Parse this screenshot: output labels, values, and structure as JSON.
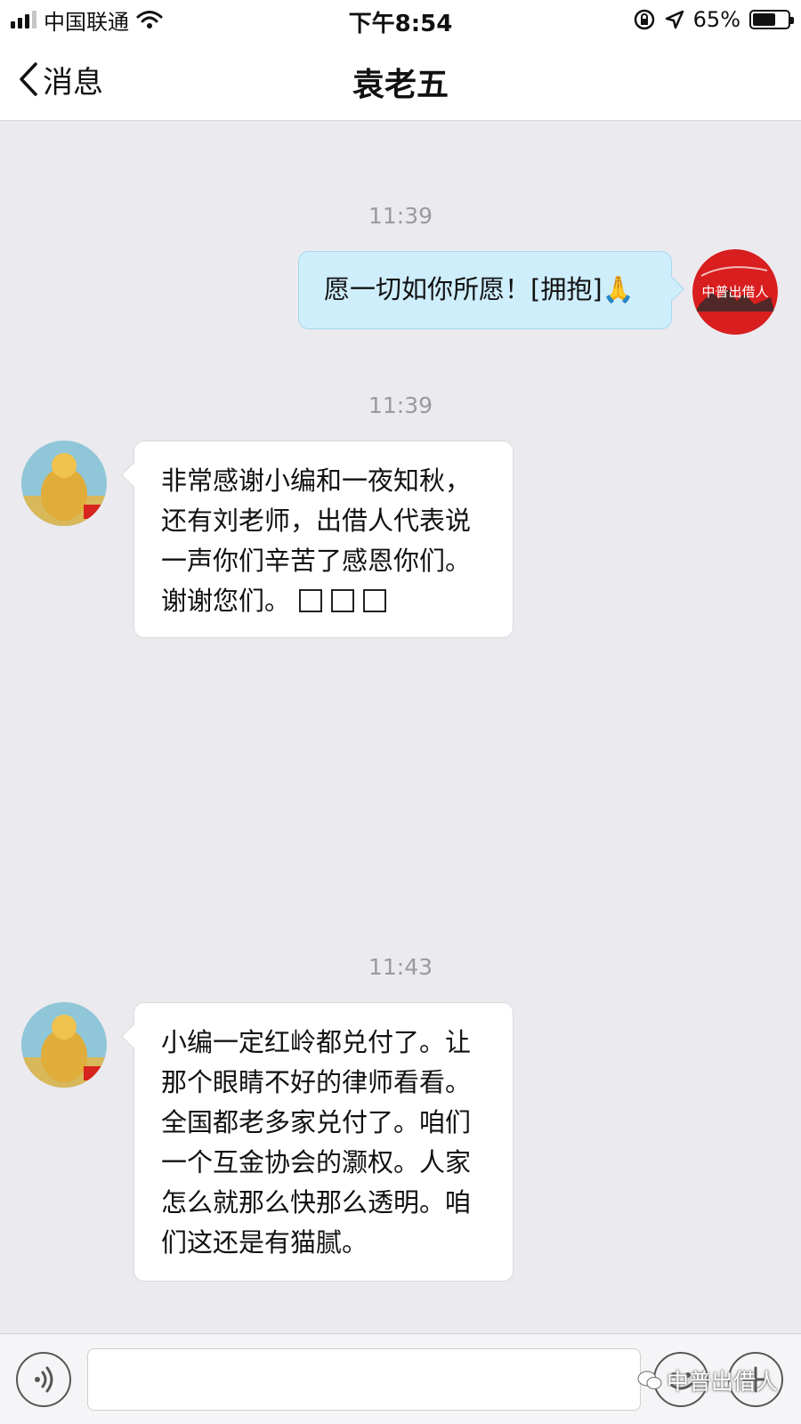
{
  "status_bar": {
    "carrier": "中国联通",
    "time": "下午8:54",
    "battery_percent": "65%",
    "battery_level": 0.65
  },
  "nav": {
    "back_label": "消息",
    "title": "袁老五"
  },
  "messages": [
    {
      "timestamp": "11:39",
      "direction": "outgoing",
      "text": "愿一切如你所愿！[拥抱]🙏",
      "avatar_text": "中普出借人"
    },
    {
      "timestamp": "11:39",
      "direction": "incoming",
      "text": "非常感谢小编和一夜知秋，\n还有刘老师，出借人代表说\n一声你们辛苦了感恩你们。\n谢谢您们。",
      "trailing_glyphs": 3
    },
    {
      "timestamp": "11:43",
      "direction": "incoming",
      "text": "小编一定红岭都兑付了。让\n那个眼睛不好的律师看看。\n全国都老多家兑付了。咱们\n一个互金协会的灏权。人家\n怎么就那么快那么透明。咱\n们这还是有猫腻。"
    }
  ],
  "input_bar": {
    "placeholder": "",
    "watermark": "中普出借人",
    "icons": [
      "voice-icon",
      "emoji-icon",
      "add-icon"
    ]
  },
  "colors": {
    "chat_background": "#ebeaef",
    "outgoing_bubble": "#cfeefc",
    "incoming_bubble": "#ffffff",
    "timestamp_text": "#9a9a9f"
  }
}
